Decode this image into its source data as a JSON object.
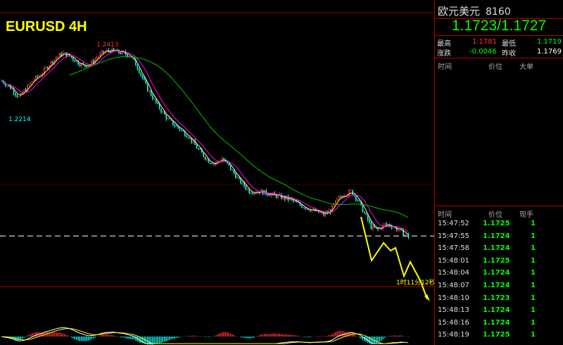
{
  "chart_title": "EURUSD 4H",
  "chart_data": {
    "type": "candlestick",
    "title": "EURUSD 4H",
    "ylim": [
      1.169,
      1.243
    ],
    "annotations": {
      "high": "1.2413",
      "low": "1.2214",
      "countdown": "1时11分12秒"
    },
    "dashed_level": 1.1728,
    "waypoints": [
      [
        0,
        1.229
      ],
      [
        6,
        1.226
      ],
      [
        10,
        1.223
      ],
      [
        14,
        1.226
      ],
      [
        18,
        1.229
      ],
      [
        24,
        1.232
      ],
      [
        28,
        1.235
      ],
      [
        32,
        1.2375
      ],
      [
        36,
        1.239
      ],
      [
        40,
        1.238
      ],
      [
        44,
        1.236
      ],
      [
        48,
        1.2345
      ],
      [
        52,
        1.235
      ],
      [
        56,
        1.2375
      ],
      [
        60,
        1.2395
      ],
      [
        64,
        1.24
      ],
      [
        68,
        1.2395
      ],
      [
        72,
        1.239
      ],
      [
        76,
        1.238
      ],
      [
        80,
        1.234
      ],
      [
        86,
        1.226
      ],
      [
        92,
        1.22
      ],
      [
        98,
        1.215
      ],
      [
        104,
        1.212
      ],
      [
        110,
        1.209
      ],
      [
        116,
        1.204
      ],
      [
        122,
        1.2
      ],
      [
        126,
        1.199
      ],
      [
        130,
        1.201
      ],
      [
        134,
        1.198
      ],
      [
        140,
        1.193
      ],
      [
        146,
        1.189
      ],
      [
        152,
        1.189
      ],
      [
        158,
        1.188
      ],
      [
        164,
        1.187
      ],
      [
        170,
        1.186
      ],
      [
        176,
        1.184
      ],
      [
        182,
        1.1825
      ],
      [
        186,
        1.1815
      ],
      [
        190,
        1.1805
      ],
      [
        194,
        1.182
      ],
      [
        198,
        1.186
      ],
      [
        202,
        1.188
      ],
      [
        206,
        1.189
      ],
      [
        210,
        1.186
      ],
      [
        214,
        1.181
      ],
      [
        218,
        1.176
      ],
      [
        222,
        1.175
      ],
      [
        226,
        1.177
      ],
      [
        230,
        1.1765
      ],
      [
        234,
        1.175
      ],
      [
        238,
        1.1735
      ],
      [
        240,
        1.1725
      ]
    ],
    "candle_count": 241
  },
  "side": {
    "name": "欧元美元",
    "code": "8160",
    "quote": "1.1723/1.1727",
    "high_label": "最高",
    "high": "1.1781",
    "low_label": "最低",
    "low": "1.1719",
    "chg_label": "涨跌",
    "chg": "-0.0046",
    "prev_label": "昨收",
    "prev": "1.1769",
    "big_head": {
      "time": "时间",
      "price": "价位",
      "big": "大单"
    },
    "tick_head": {
      "time": "时间",
      "price": "价位",
      "vol": "现手"
    },
    "ticks": [
      {
        "time": "15:47:52",
        "price": "1.1725",
        "vol": "1"
      },
      {
        "time": "15:47:55",
        "price": "1.1724",
        "vol": "1"
      },
      {
        "time": "15:47:58",
        "price": "1.1724",
        "vol": "1"
      },
      {
        "time": "15:48:01",
        "price": "1.1725",
        "vol": "1"
      },
      {
        "time": "15:48:04",
        "price": "1.1724",
        "vol": "1"
      },
      {
        "time": "15:48:07",
        "price": "1.1724",
        "vol": "1"
      },
      {
        "time": "15:48:10",
        "price": "1.1723",
        "vol": "1"
      },
      {
        "time": "15:48:13",
        "price": "1.1724",
        "vol": "1"
      },
      {
        "time": "15:48:16",
        "price": "1.1724",
        "vol": "1"
      },
      {
        "time": "15:48:19",
        "price": "1.1725",
        "vol": "1"
      }
    ]
  },
  "colors": {
    "up": "#ff3030",
    "down": "#00ffff",
    "ma_fast": "#ffff66",
    "ma_mid": "#ff00ff",
    "ma_slow": "#00c000",
    "title": "#ffff00",
    "frame": "#b00000",
    "arrow": "#ffff00"
  }
}
